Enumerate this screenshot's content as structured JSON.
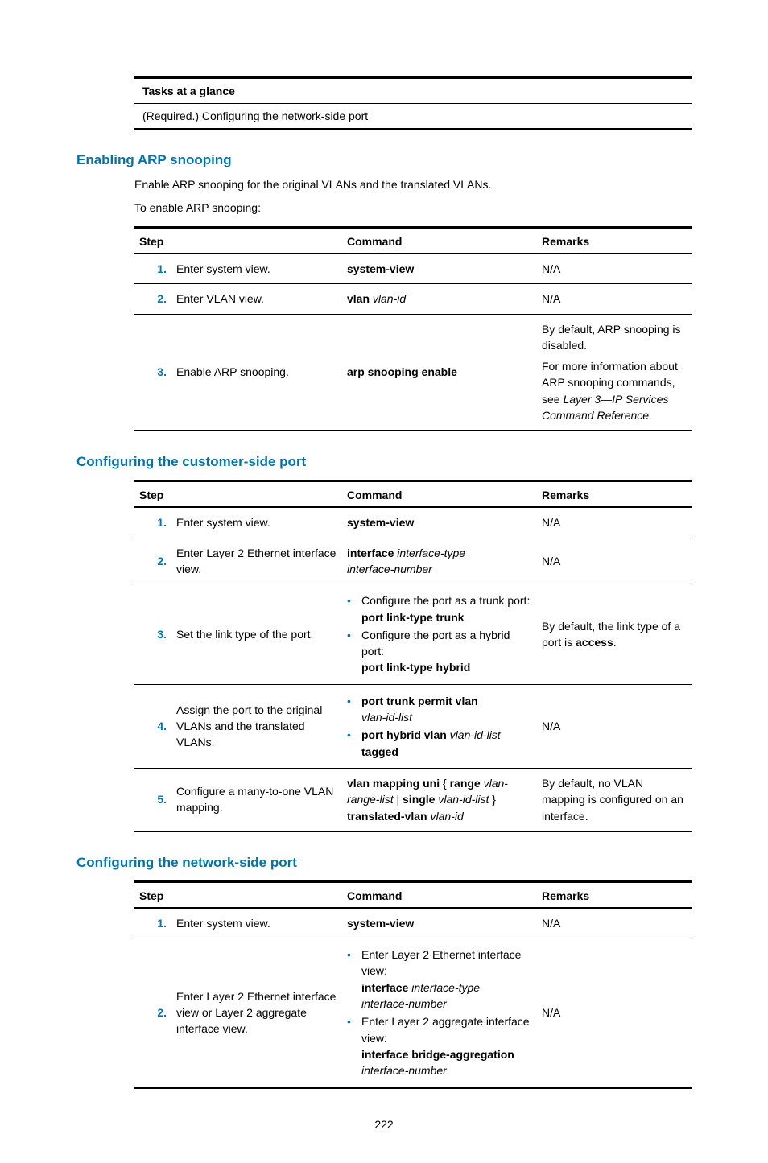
{
  "tasksTable": {
    "header": "Tasks at a glance",
    "row": "(Required.) Configuring the network-side port"
  },
  "sections": {
    "arp": {
      "heading": "Enabling ARP snooping",
      "para1": "Enable ARP snooping for the original VLANs and the translated VLANs.",
      "para2": "To enable ARP snooping:",
      "tbl": {
        "h1": "Step",
        "h2": "Command",
        "h3": "Remarks",
        "r1": {
          "n": "1.",
          "step": "Enter system view.",
          "cmd": "system-view",
          "rem": "N/A"
        },
        "r2": {
          "n": "2.",
          "step": "Enter VLAN view.",
          "cmd_b": "vlan",
          "cmd_i": " vlan-id",
          "rem": "N/A"
        },
        "r3": {
          "n": "3.",
          "step": "Enable ARP snooping.",
          "cmd": "arp snooping enable",
          "rem_a": "By default, ARP snooping is disabled.",
          "rem_b": "For more information about ARP snooping commands, see ",
          "rem_i": "Layer 3—IP Services Command Reference.",
          "rem_end": ""
        }
      }
    },
    "cust": {
      "heading": "Configuring the customer-side port",
      "tbl": {
        "h1": "Step",
        "h2": "Command",
        "h3": "Remarks",
        "r1": {
          "n": "1.",
          "step": "Enter system view.",
          "cmd": "system-view",
          "rem": "N/A"
        },
        "r2": {
          "n": "2.",
          "step": "Enter Layer 2 Ethernet interface view.",
          "cmd_b": "interface",
          "cmd_i1": " interface-type",
          "cmd_i2": "interface-number",
          "rem": "N/A"
        },
        "r3": {
          "n": "3.",
          "step": "Set the link type of the port.",
          "li1a": "Configure the port as a trunk port:",
          "li1b": "port link-type trunk",
          "li2a": "Configure the port as a hybrid port:",
          "li2b": "port link-type hybrid",
          "rem_a": "By default, the link type of a port is ",
          "rem_b": "access",
          "rem_c": "."
        },
        "r4": {
          "n": "4.",
          "step": "Assign the port to the original VLANs and the translated VLANs.",
          "li1b": "port trunk permit vlan",
          "li1i": "vlan-id-list",
          "li2b": "port hybrid vlan",
          "li2i": " vlan-id-list",
          "li2b2": " tagged",
          "rem": "N/A"
        },
        "r5": {
          "n": "5.",
          "step": "Configure a many-to-one VLAN mapping.",
          "cmd_b1": "vlan mapping uni",
          "cmd_t1": " { ",
          "cmd_b2": "range",
          "cmd_i1": " vlan-range-list",
          "cmd_t2": " | ",
          "cmd_b3": "single",
          "cmd_i2": " vlan-id-list",
          "cmd_t3": " } ",
          "cmd_b4": "translated-vlan",
          "cmd_i3": " vlan-id",
          "rem": "By default, no VLAN mapping is configured on an interface."
        }
      }
    },
    "net": {
      "heading": "Configuring the network-side port",
      "tbl": {
        "h1": "Step",
        "h2": "Command",
        "h3": "Remarks",
        "r1": {
          "n": "1.",
          "step": "Enter system view.",
          "cmd": "system-view",
          "rem": "N/A"
        },
        "r2": {
          "n": "2.",
          "step": "Enter Layer 2 Ethernet interface view or Layer 2 aggregate interface view.",
          "li1a": "Enter Layer 2 Ethernet interface view:",
          "li1b": "interface",
          "li1i1": " interface-type",
          "li1i2": "interface-number",
          "li2a": "Enter Layer 2 aggregate interface view:",
          "li2b": "interface bridge-aggregation",
          "li2i": "interface-number",
          "rem": "N/A"
        }
      }
    }
  },
  "pageNumber": "222"
}
